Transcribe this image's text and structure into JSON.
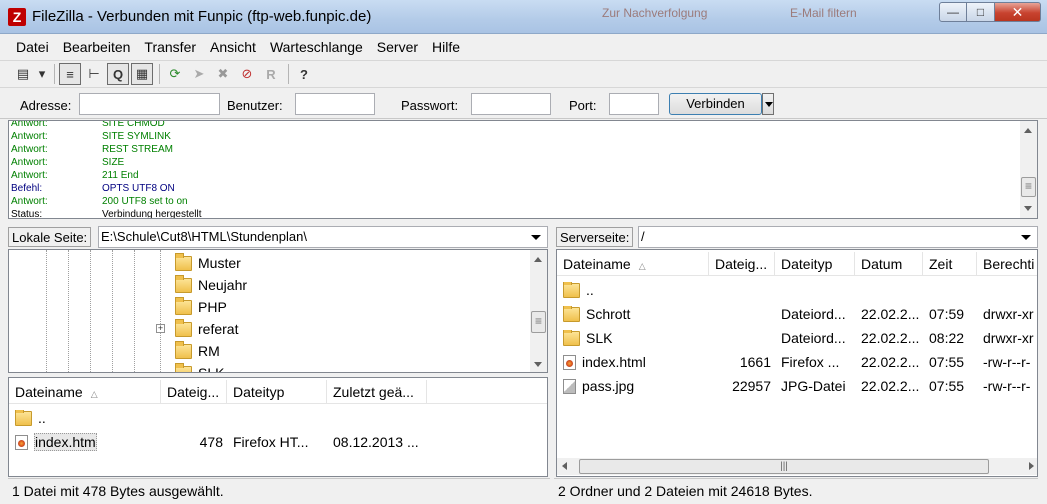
{
  "window": {
    "title": "FileZilla - Verbunden mit Funpic (ftp-web.funpic.de)",
    "icon_letter": "Z",
    "background_tabs": [
      "Zur Nachverfolgung",
      "E-Mail filtern"
    ]
  },
  "menu": [
    "Datei",
    "Bearbeiten",
    "Transfer",
    "Ansicht",
    "Warteschlange",
    "Server",
    "Hilfe"
  ],
  "toolbar": {
    "icons": [
      "site-manager-icon",
      "dropdown-arrow-icon",
      "toggle-log-icon",
      "toggle-local-tree-icon",
      "toggle-remote-tree-icon",
      "toggle-queue-icon",
      "refresh-icon",
      "process-queue-icon",
      "cancel-icon",
      "disconnect-icon",
      "reconnect-icon",
      "filter-icon",
      "search-icon"
    ]
  },
  "quickconnect": {
    "host_label": "Adresse:",
    "user_label": "Benutzer:",
    "pass_label": "Passwort:",
    "port_label": "Port:",
    "host_value": "",
    "user_value": "",
    "pass_value": "",
    "port_value": "",
    "connect_label": "Verbinden"
  },
  "log": [
    {
      "type": "Antwort:",
      "msg": "SITE CHMOD",
      "color": "green"
    },
    {
      "type": "Antwort:",
      "msg": "SITE SYMLINK",
      "color": "green"
    },
    {
      "type": "Antwort:",
      "msg": "REST STREAM",
      "color": "green"
    },
    {
      "type": "Antwort:",
      "msg": "SIZE",
      "color": "green"
    },
    {
      "type": "Antwort:",
      "msg": "211 End",
      "color": "green"
    },
    {
      "type": "Befehl:",
      "msg": "OPTS UTF8 ON",
      "color": "navy"
    },
    {
      "type": "Antwort:",
      "msg": "200 UTF8 set to on",
      "color": "green"
    },
    {
      "type": "Status:",
      "msg": "Verbindung hergestellt",
      "color": "black"
    }
  ],
  "local": {
    "path_label": "Lokale Seite:",
    "path": "E:\\Schule\\Cut8\\HTML\\Stundenplan\\",
    "tree": [
      "Muster",
      "Neujahr",
      "PHP",
      "referat",
      "RM",
      "SLK"
    ],
    "columns": [
      "Dateiname",
      "Dateig...",
      "Dateityp",
      "Zuletzt geä..."
    ],
    "files": [
      {
        "name": "..",
        "size": "",
        "type": "",
        "date": "",
        "icon": "folder"
      },
      {
        "name": "index.htm",
        "size": "478",
        "type": "Firefox HT...",
        "date": "08.12.2013 ...",
        "icon": "html"
      }
    ],
    "status": "1 Datei mit 478 Bytes ausgewählt."
  },
  "remote": {
    "path_label": "Serverseite:",
    "path": "/",
    "columns": [
      "Dateiname",
      "Dateig...",
      "Dateityp",
      "Datum",
      "Zeit",
      "Berechti"
    ],
    "files": [
      {
        "name": "..",
        "size": "",
        "type": "",
        "date": "",
        "time": "",
        "perm": "",
        "icon": "folder"
      },
      {
        "name": "Schrott",
        "size": "",
        "type": "Dateiord...",
        "date": "22.02.2...",
        "time": "07:59",
        "perm": "drwxr-xr",
        "icon": "folder"
      },
      {
        "name": "SLK",
        "size": "",
        "type": "Dateiord...",
        "date": "22.02.2...",
        "time": "08:22",
        "perm": "drwxr-xr",
        "icon": "folder"
      },
      {
        "name": "index.html",
        "size": "1661",
        "type": "Firefox ...",
        "date": "22.02.2...",
        "time": "07:55",
        "perm": "-rw-r--r-",
        "icon": "html"
      },
      {
        "name": "pass.jpg",
        "size": "22957",
        "type": "JPG-Datei",
        "date": "22.02.2...",
        "time": "07:55",
        "perm": "-rw-r--r-",
        "icon": "image"
      }
    ],
    "status": "2 Ordner und 2 Dateien mit 24618 Bytes."
  },
  "colors": {
    "log_response": "#008000",
    "log_command": "#000080",
    "close_button": "#c8432f"
  }
}
